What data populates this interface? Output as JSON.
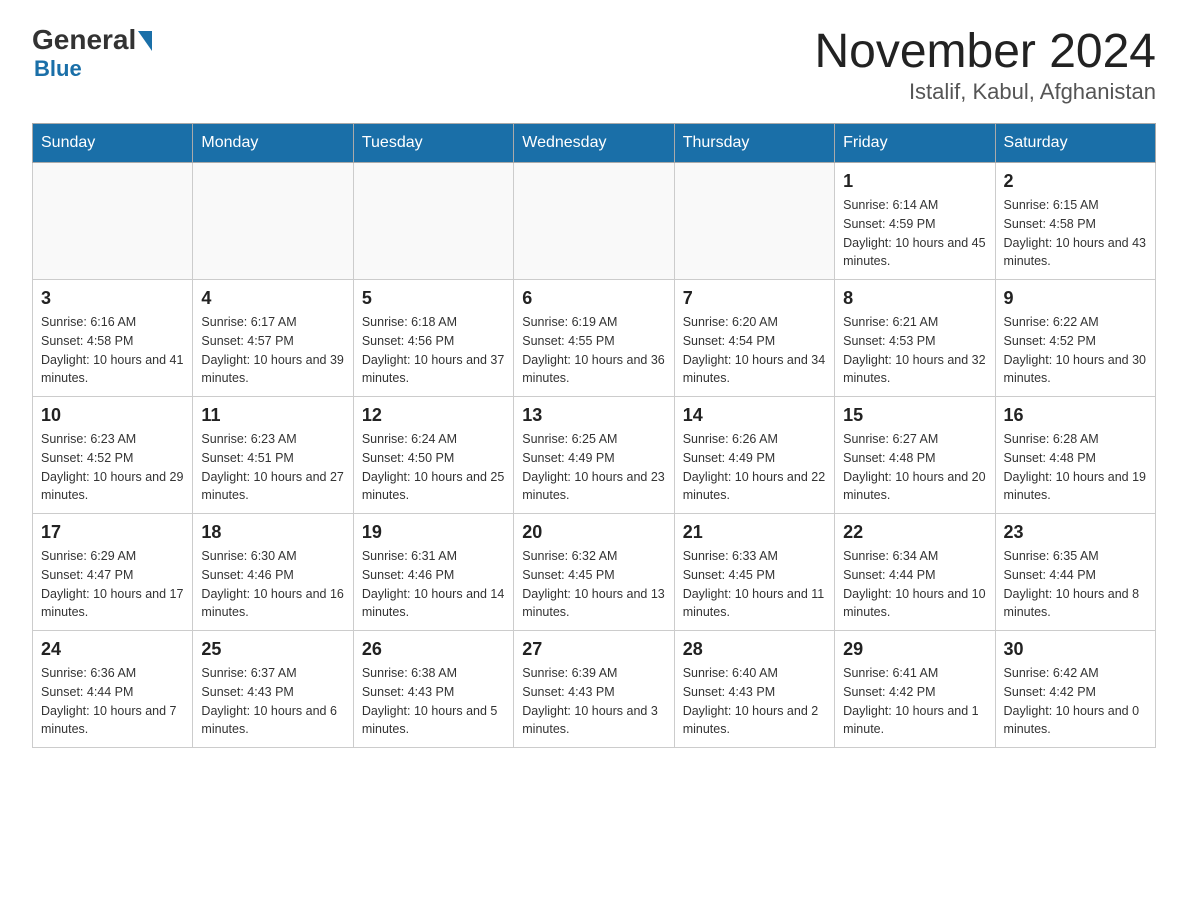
{
  "header": {
    "logo_text": "General",
    "logo_blue": "Blue",
    "title": "November 2024",
    "subtitle": "Istalif, Kabul, Afghanistan"
  },
  "days_of_week": [
    "Sunday",
    "Monday",
    "Tuesday",
    "Wednesday",
    "Thursday",
    "Friday",
    "Saturday"
  ],
  "weeks": [
    [
      {
        "day": "",
        "info": ""
      },
      {
        "day": "",
        "info": ""
      },
      {
        "day": "",
        "info": ""
      },
      {
        "day": "",
        "info": ""
      },
      {
        "day": "",
        "info": ""
      },
      {
        "day": "1",
        "info": "Sunrise: 6:14 AM\nSunset: 4:59 PM\nDaylight: 10 hours and 45 minutes."
      },
      {
        "day": "2",
        "info": "Sunrise: 6:15 AM\nSunset: 4:58 PM\nDaylight: 10 hours and 43 minutes."
      }
    ],
    [
      {
        "day": "3",
        "info": "Sunrise: 6:16 AM\nSunset: 4:58 PM\nDaylight: 10 hours and 41 minutes."
      },
      {
        "day": "4",
        "info": "Sunrise: 6:17 AM\nSunset: 4:57 PM\nDaylight: 10 hours and 39 minutes."
      },
      {
        "day": "5",
        "info": "Sunrise: 6:18 AM\nSunset: 4:56 PM\nDaylight: 10 hours and 37 minutes."
      },
      {
        "day": "6",
        "info": "Sunrise: 6:19 AM\nSunset: 4:55 PM\nDaylight: 10 hours and 36 minutes."
      },
      {
        "day": "7",
        "info": "Sunrise: 6:20 AM\nSunset: 4:54 PM\nDaylight: 10 hours and 34 minutes."
      },
      {
        "day": "8",
        "info": "Sunrise: 6:21 AM\nSunset: 4:53 PM\nDaylight: 10 hours and 32 minutes."
      },
      {
        "day": "9",
        "info": "Sunrise: 6:22 AM\nSunset: 4:52 PM\nDaylight: 10 hours and 30 minutes."
      }
    ],
    [
      {
        "day": "10",
        "info": "Sunrise: 6:23 AM\nSunset: 4:52 PM\nDaylight: 10 hours and 29 minutes."
      },
      {
        "day": "11",
        "info": "Sunrise: 6:23 AM\nSunset: 4:51 PM\nDaylight: 10 hours and 27 minutes."
      },
      {
        "day": "12",
        "info": "Sunrise: 6:24 AM\nSunset: 4:50 PM\nDaylight: 10 hours and 25 minutes."
      },
      {
        "day": "13",
        "info": "Sunrise: 6:25 AM\nSunset: 4:49 PM\nDaylight: 10 hours and 23 minutes."
      },
      {
        "day": "14",
        "info": "Sunrise: 6:26 AM\nSunset: 4:49 PM\nDaylight: 10 hours and 22 minutes."
      },
      {
        "day": "15",
        "info": "Sunrise: 6:27 AM\nSunset: 4:48 PM\nDaylight: 10 hours and 20 minutes."
      },
      {
        "day": "16",
        "info": "Sunrise: 6:28 AM\nSunset: 4:48 PM\nDaylight: 10 hours and 19 minutes."
      }
    ],
    [
      {
        "day": "17",
        "info": "Sunrise: 6:29 AM\nSunset: 4:47 PM\nDaylight: 10 hours and 17 minutes."
      },
      {
        "day": "18",
        "info": "Sunrise: 6:30 AM\nSunset: 4:46 PM\nDaylight: 10 hours and 16 minutes."
      },
      {
        "day": "19",
        "info": "Sunrise: 6:31 AM\nSunset: 4:46 PM\nDaylight: 10 hours and 14 minutes."
      },
      {
        "day": "20",
        "info": "Sunrise: 6:32 AM\nSunset: 4:45 PM\nDaylight: 10 hours and 13 minutes."
      },
      {
        "day": "21",
        "info": "Sunrise: 6:33 AM\nSunset: 4:45 PM\nDaylight: 10 hours and 11 minutes."
      },
      {
        "day": "22",
        "info": "Sunrise: 6:34 AM\nSunset: 4:44 PM\nDaylight: 10 hours and 10 minutes."
      },
      {
        "day": "23",
        "info": "Sunrise: 6:35 AM\nSunset: 4:44 PM\nDaylight: 10 hours and 8 minutes."
      }
    ],
    [
      {
        "day": "24",
        "info": "Sunrise: 6:36 AM\nSunset: 4:44 PM\nDaylight: 10 hours and 7 minutes."
      },
      {
        "day": "25",
        "info": "Sunrise: 6:37 AM\nSunset: 4:43 PM\nDaylight: 10 hours and 6 minutes."
      },
      {
        "day": "26",
        "info": "Sunrise: 6:38 AM\nSunset: 4:43 PM\nDaylight: 10 hours and 5 minutes."
      },
      {
        "day": "27",
        "info": "Sunrise: 6:39 AM\nSunset: 4:43 PM\nDaylight: 10 hours and 3 minutes."
      },
      {
        "day": "28",
        "info": "Sunrise: 6:40 AM\nSunset: 4:43 PM\nDaylight: 10 hours and 2 minutes."
      },
      {
        "day": "29",
        "info": "Sunrise: 6:41 AM\nSunset: 4:42 PM\nDaylight: 10 hours and 1 minute."
      },
      {
        "day": "30",
        "info": "Sunrise: 6:42 AM\nSunset: 4:42 PM\nDaylight: 10 hours and 0 minutes."
      }
    ]
  ]
}
